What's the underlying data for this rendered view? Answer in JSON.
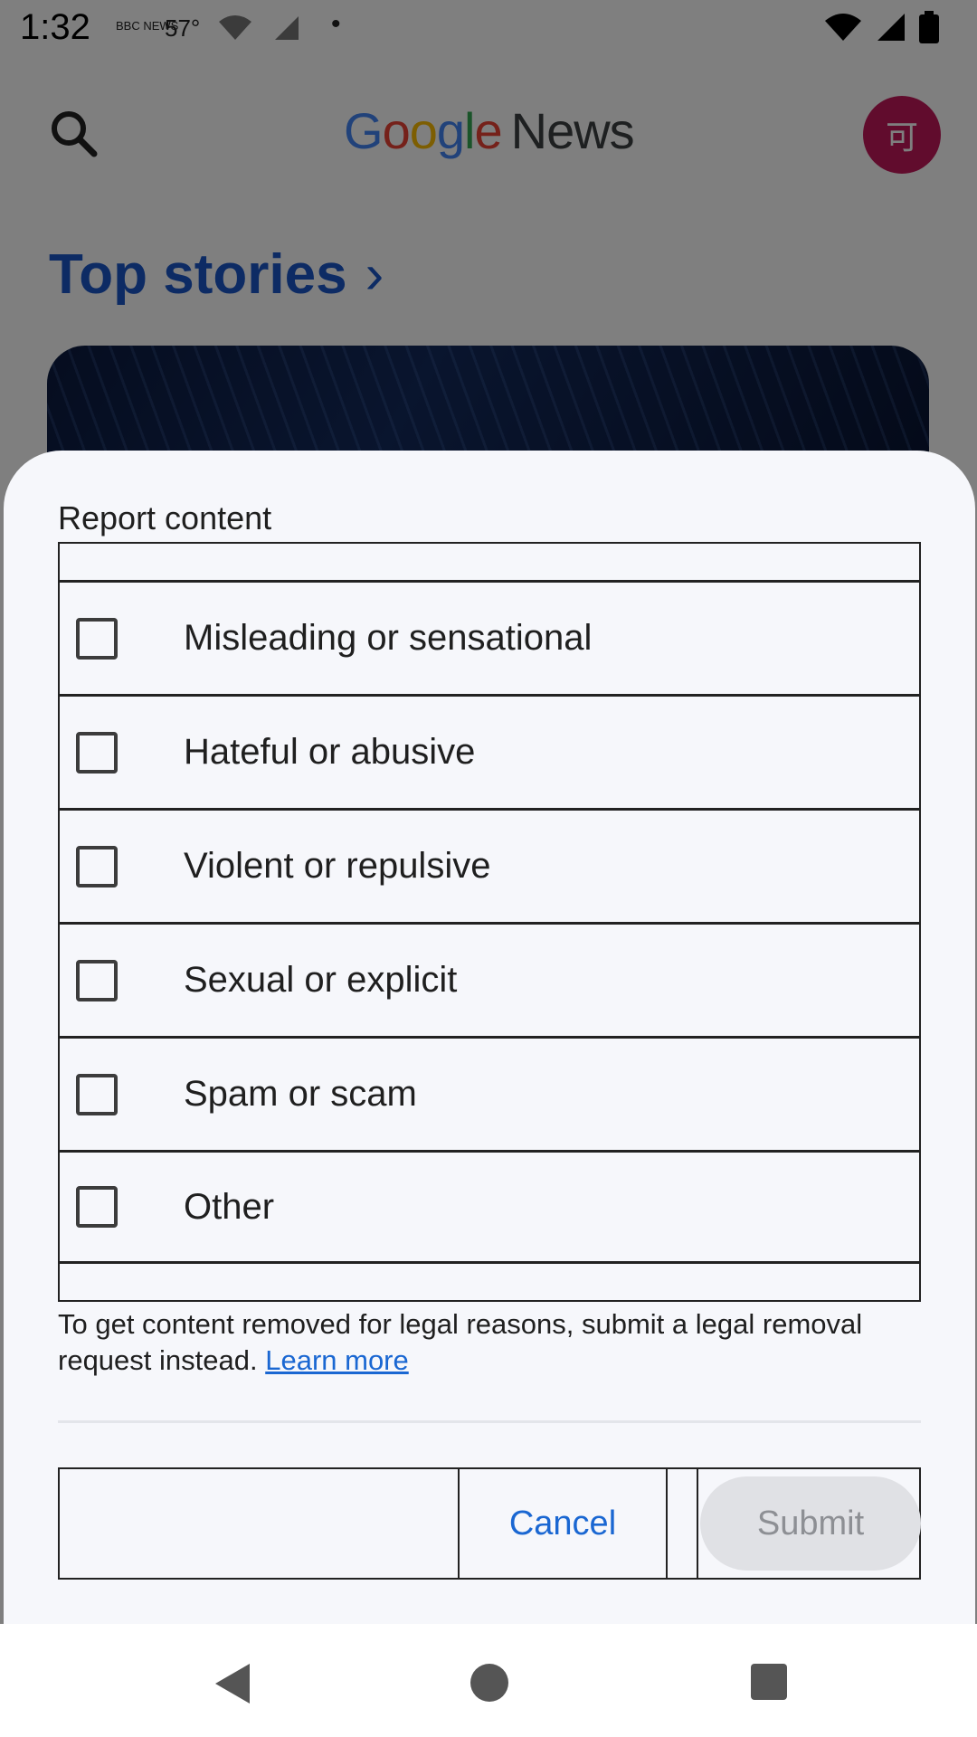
{
  "status_bar": {
    "time": "1:32",
    "news_badge": "BBC NEWS",
    "temperature": "57°",
    "dot": "•"
  },
  "app_bar": {
    "logo_letters": [
      "G",
      "o",
      "o",
      "g",
      "l",
      "e"
    ],
    "logo_word": "News",
    "avatar_initial": "可"
  },
  "section": {
    "title": "Top stories",
    "chevron": "›"
  },
  "dialog": {
    "title": "Report content",
    "options": [
      {
        "label": "Misleading or sensational",
        "checked": false
      },
      {
        "label": "Hateful or abusive",
        "checked": false
      },
      {
        "label": "Violent or repulsive",
        "checked": false
      },
      {
        "label": "Sexual or explicit",
        "checked": false
      },
      {
        "label": "Spam or scam",
        "checked": false
      },
      {
        "label": "Other",
        "checked": false
      }
    ],
    "legal_text": "To get content removed for legal reasons, submit a legal removal request instead.",
    "learn_more": "Learn more",
    "cancel_label": "Cancel",
    "submit_label": "Submit"
  },
  "colors": {
    "accent": "#1a67d2",
    "scrim": "rgba(0,0,0,0.5)",
    "sheet_bg": "#f6f7fb",
    "avatar_bg": "#c2185b"
  }
}
